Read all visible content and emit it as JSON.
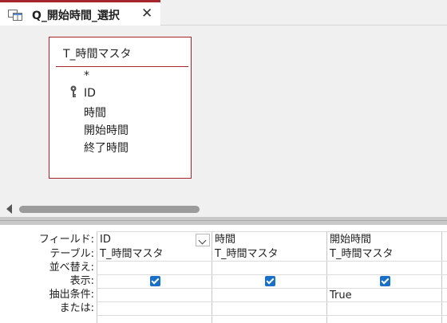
{
  "tab": {
    "title": "Q_開始時間_選択",
    "close": "✕"
  },
  "table": {
    "title": "T_時間マスタ",
    "fields": [
      "*",
      "ID",
      "時間",
      "開始時間",
      "終了時間"
    ]
  },
  "grid": {
    "row_labels": [
      "フィールド:",
      "テーブル:",
      "並べ替え:",
      "表示:",
      "抽出条件:",
      "または:"
    ],
    "columns": [
      {
        "field": "ID",
        "table": "T_時間マスタ",
        "show": true,
        "criteria": ""
      },
      {
        "field": "時間",
        "table": "T_時間マスタ",
        "show": true,
        "criteria": ""
      },
      {
        "field": "開始時間",
        "table": "T_時間マスタ",
        "show": true,
        "criteria": "True"
      }
    ]
  },
  "colors": {
    "accent": "#a4262c",
    "checkbox": "#1a6fc9"
  }
}
